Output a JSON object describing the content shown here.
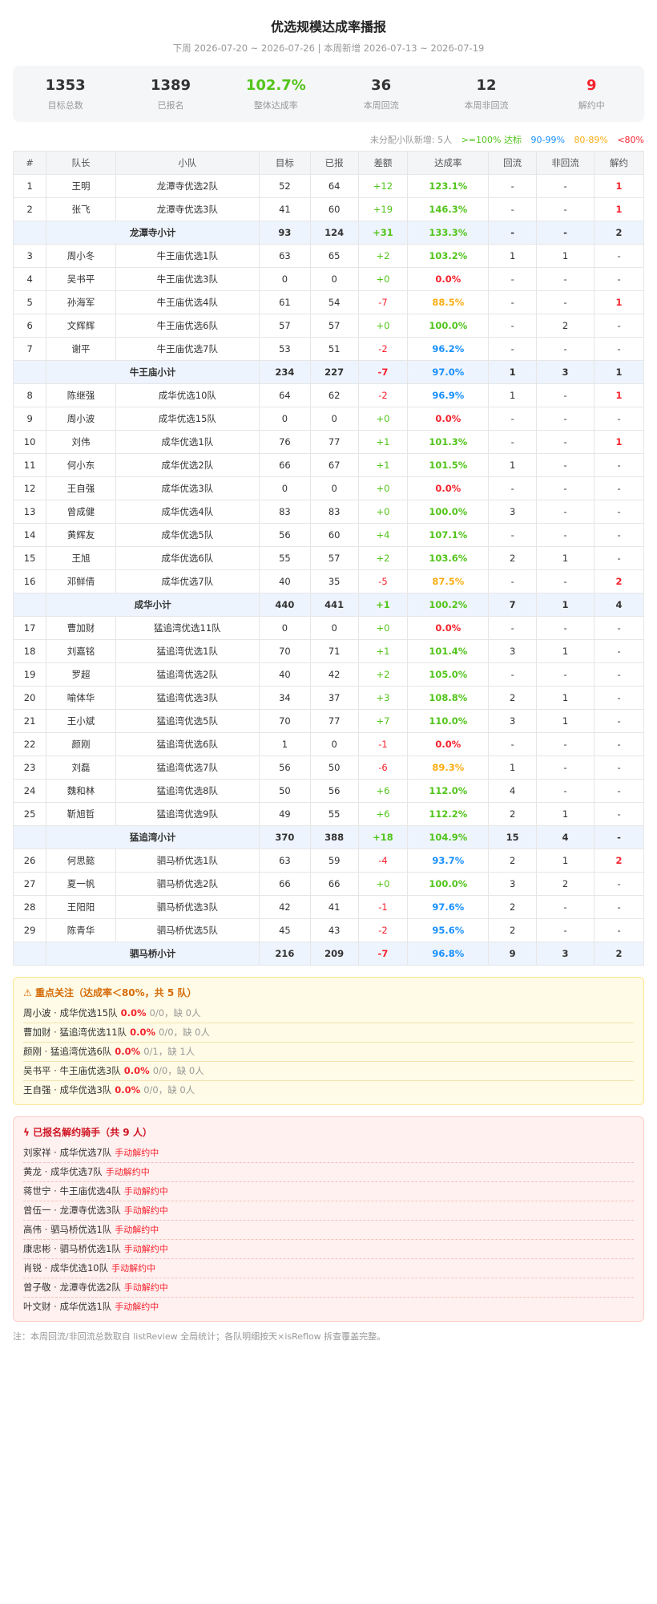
{
  "header": {
    "title": "优选规模达成率播报",
    "subtitle": "下周 2026-07-20 ~ 2026-07-26 | 本周新增 2026-07-13 ~ 2026-07-19"
  },
  "summary": [
    {
      "value": "1353",
      "label": "目标总数",
      "color": "#333333"
    },
    {
      "value": "1389",
      "label": "已报名",
      "color": "#333333"
    },
    {
      "value": "102.7%",
      "label": "整体达成率",
      "color": "#52c41a"
    },
    {
      "value": "36",
      "label": "本周回流",
      "color": "#333333"
    },
    {
      "value": "12",
      "label": "本周非回流",
      "color": "#333333"
    },
    {
      "value": "9",
      "label": "解约中",
      "color": "#f5222d"
    }
  ],
  "legend": {
    "unassigned": "未分配小队新增: 5人",
    "green": ">=100% 达标",
    "blue": "90-99%",
    "orange": "80-89%",
    "red": "<80%"
  },
  "table": {
    "headers": [
      "#",
      "队长",
      "小队",
      "目标",
      "已报",
      "差额",
      "达成率",
      "回流",
      "非回流",
      "解约"
    ],
    "rows": [
      {
        "type": "row",
        "idx": "1",
        "captain": "王明",
        "team": "龙潭寺优选2队",
        "target": "52",
        "signed": "64",
        "diff": "+12",
        "rate": "123.1%",
        "back": "-",
        "nonback": "-",
        "cancel": "1"
      },
      {
        "type": "row",
        "idx": "2",
        "captain": "张飞",
        "team": "龙潭寺优选3队",
        "target": "41",
        "signed": "60",
        "diff": "+19",
        "rate": "146.3%",
        "back": "-",
        "nonback": "-",
        "cancel": "1"
      },
      {
        "type": "sub",
        "name": "龙潭寺小计",
        "target": "93",
        "signed": "124",
        "diff": "+31",
        "rate": "133.3%",
        "back": "-",
        "nonback": "-",
        "cancel": "2"
      },
      {
        "type": "row",
        "idx": "3",
        "captain": "周小冬",
        "team": "牛王庙优选1队",
        "target": "63",
        "signed": "65",
        "diff": "+2",
        "rate": "103.2%",
        "back": "1",
        "nonback": "1",
        "cancel": "-"
      },
      {
        "type": "row",
        "idx": "4",
        "captain": "吴书平",
        "team": "牛王庙优选3队",
        "target": "0",
        "signed": "0",
        "diff": "+0",
        "rate": "0.0%",
        "back": "-",
        "nonback": "-",
        "cancel": "-"
      },
      {
        "type": "row",
        "idx": "5",
        "captain": "孙海军",
        "team": "牛王庙优选4队",
        "target": "61",
        "signed": "54",
        "diff": "-7",
        "rate": "88.5%",
        "back": "-",
        "nonback": "-",
        "cancel": "1"
      },
      {
        "type": "row",
        "idx": "6",
        "captain": "文辉辉",
        "team": "牛王庙优选6队",
        "target": "57",
        "signed": "57",
        "diff": "+0",
        "rate": "100.0%",
        "back": "-",
        "nonback": "2",
        "cancel": "-"
      },
      {
        "type": "row",
        "idx": "7",
        "captain": "谢平",
        "team": "牛王庙优选7队",
        "target": "53",
        "signed": "51",
        "diff": "-2",
        "rate": "96.2%",
        "back": "-",
        "nonback": "-",
        "cancel": "-"
      },
      {
        "type": "sub",
        "name": "牛王庙小计",
        "target": "234",
        "signed": "227",
        "diff": "-7",
        "rate": "97.0%",
        "back": "1",
        "nonback": "3",
        "cancel": "1"
      },
      {
        "type": "row",
        "idx": "8",
        "captain": "陈继强",
        "team": "成华优选10队",
        "target": "64",
        "signed": "62",
        "diff": "-2",
        "rate": "96.9%",
        "back": "1",
        "nonback": "-",
        "cancel": "1"
      },
      {
        "type": "row",
        "idx": "9",
        "captain": "周小波",
        "team": "成华优选15队",
        "target": "0",
        "signed": "0",
        "diff": "+0",
        "rate": "0.0%",
        "back": "-",
        "nonback": "-",
        "cancel": "-"
      },
      {
        "type": "row",
        "idx": "10",
        "captain": "刘伟",
        "team": "成华优选1队",
        "target": "76",
        "signed": "77",
        "diff": "+1",
        "rate": "101.3%",
        "back": "-",
        "nonback": "-",
        "cancel": "1"
      },
      {
        "type": "row",
        "idx": "11",
        "captain": "何小东",
        "team": "成华优选2队",
        "target": "66",
        "signed": "67",
        "diff": "+1",
        "rate": "101.5%",
        "back": "1",
        "nonback": "-",
        "cancel": "-"
      },
      {
        "type": "row",
        "idx": "12",
        "captain": "王自强",
        "team": "成华优选3队",
        "target": "0",
        "signed": "0",
        "diff": "+0",
        "rate": "0.0%",
        "back": "-",
        "nonback": "-",
        "cancel": "-"
      },
      {
        "type": "row",
        "idx": "13",
        "captain": "曾成健",
        "team": "成华优选4队",
        "target": "83",
        "signed": "83",
        "diff": "+0",
        "rate": "100.0%",
        "back": "3",
        "nonback": "-",
        "cancel": "-"
      },
      {
        "type": "row",
        "idx": "14",
        "captain": "黄辉友",
        "team": "成华优选5队",
        "target": "56",
        "signed": "60",
        "diff": "+4",
        "rate": "107.1%",
        "back": "-",
        "nonback": "-",
        "cancel": "-"
      },
      {
        "type": "row",
        "idx": "15",
        "captain": "王旭",
        "team": "成华优选6队",
        "target": "55",
        "signed": "57",
        "diff": "+2",
        "rate": "103.6%",
        "back": "2",
        "nonback": "1",
        "cancel": "-"
      },
      {
        "type": "row",
        "idx": "16",
        "captain": "邓鲜倩",
        "team": "成华优选7队",
        "target": "40",
        "signed": "35",
        "diff": "-5",
        "rate": "87.5%",
        "back": "-",
        "nonback": "-",
        "cancel": "2"
      },
      {
        "type": "sub",
        "name": "成华小计",
        "target": "440",
        "signed": "441",
        "diff": "+1",
        "rate": "100.2%",
        "back": "7",
        "nonback": "1",
        "cancel": "4"
      },
      {
        "type": "row",
        "idx": "17",
        "captain": "曹加财",
        "team": "猛追湾优选11队",
        "target": "0",
        "signed": "0",
        "diff": "+0",
        "rate": "0.0%",
        "back": "-",
        "nonback": "-",
        "cancel": "-"
      },
      {
        "type": "row",
        "idx": "18",
        "captain": "刘嘉铭",
        "team": "猛追湾优选1队",
        "target": "70",
        "signed": "71",
        "diff": "+1",
        "rate": "101.4%",
        "back": "3",
        "nonback": "1",
        "cancel": "-"
      },
      {
        "type": "row",
        "idx": "19",
        "captain": "罗超",
        "team": "猛追湾优选2队",
        "target": "40",
        "signed": "42",
        "diff": "+2",
        "rate": "105.0%",
        "back": "-",
        "nonback": "-",
        "cancel": "-"
      },
      {
        "type": "row",
        "idx": "20",
        "captain": "喻体华",
        "team": "猛追湾优选3队",
        "target": "34",
        "signed": "37",
        "diff": "+3",
        "rate": "108.8%",
        "back": "2",
        "nonback": "1",
        "cancel": "-"
      },
      {
        "type": "row",
        "idx": "21",
        "captain": "王小斌",
        "team": "猛追湾优选5队",
        "target": "70",
        "signed": "77",
        "diff": "+7",
        "rate": "110.0%",
        "back": "3",
        "nonback": "1",
        "cancel": "-"
      },
      {
        "type": "row",
        "idx": "22",
        "captain": "颜刚",
        "team": "猛追湾优选6队",
        "target": "1",
        "signed": "0",
        "diff": "-1",
        "rate": "0.0%",
        "back": "-",
        "nonback": "-",
        "cancel": "-"
      },
      {
        "type": "row",
        "idx": "23",
        "captain": "刘磊",
        "team": "猛追湾优选7队",
        "target": "56",
        "signed": "50",
        "diff": "-6",
        "rate": "89.3%",
        "back": "1",
        "nonback": "-",
        "cancel": "-"
      },
      {
        "type": "row",
        "idx": "24",
        "captain": "魏和林",
        "team": "猛追湾优选8队",
        "target": "50",
        "signed": "56",
        "diff": "+6",
        "rate": "112.0%",
        "back": "4",
        "nonback": "-",
        "cancel": "-"
      },
      {
        "type": "row",
        "idx": "25",
        "captain": "靳旭哲",
        "team": "猛追湾优选9队",
        "target": "49",
        "signed": "55",
        "diff": "+6",
        "rate": "112.2%",
        "back": "2",
        "nonback": "1",
        "cancel": "-"
      },
      {
        "type": "sub",
        "name": "猛追湾小计",
        "target": "370",
        "signed": "388",
        "diff": "+18",
        "rate": "104.9%",
        "back": "15",
        "nonback": "4",
        "cancel": "-"
      },
      {
        "type": "row",
        "idx": "26",
        "captain": "何思懿",
        "team": "驷马桥优选1队",
        "target": "63",
        "signed": "59",
        "diff": "-4",
        "rate": "93.7%",
        "back": "2",
        "nonback": "1",
        "cancel": "2"
      },
      {
        "type": "row",
        "idx": "27",
        "captain": "夏一帆",
        "team": "驷马桥优选2队",
        "target": "66",
        "signed": "66",
        "diff": "+0",
        "rate": "100.0%",
        "back": "3",
        "nonback": "2",
        "cancel": "-"
      },
      {
        "type": "row",
        "idx": "28",
        "captain": "王阳阳",
        "team": "驷马桥优选3队",
        "target": "42",
        "signed": "41",
        "diff": "-1",
        "rate": "97.6%",
        "back": "2",
        "nonback": "-",
        "cancel": "-"
      },
      {
        "type": "row",
        "idx": "29",
        "captain": "陈青华",
        "team": "驷马桥优选5队",
        "target": "45",
        "signed": "43",
        "diff": "-2",
        "rate": "95.6%",
        "back": "2",
        "nonback": "-",
        "cancel": "-"
      },
      {
        "type": "sub",
        "name": "驷马桥小计",
        "target": "216",
        "signed": "209",
        "diff": "-7",
        "rate": "96.8%",
        "back": "9",
        "nonback": "3",
        "cancel": "2"
      }
    ]
  },
  "focus": {
    "title": "重点关注（达成率＜80%，共 5 队）",
    "icon": "warning-icon",
    "items": [
      {
        "name": "周小波 · 成华优选15队",
        "pct": "0.0%",
        "detail": "0/0，缺 0人"
      },
      {
        "name": "曹加财 · 猛追湾优选11队",
        "pct": "0.0%",
        "detail": "0/0，缺 0人"
      },
      {
        "name": "颜刚 · 猛追湾优选6队",
        "pct": "0.0%",
        "detail": "0/1，缺 1人"
      },
      {
        "name": "吴书平 · 牛王庙优选3队",
        "pct": "0.0%",
        "detail": "0/0，缺 0人"
      },
      {
        "name": "王自强 · 成华优选3队",
        "pct": "0.0%",
        "detail": "0/0，缺 0人"
      }
    ]
  },
  "cancel": {
    "title": "已报名解约骑手（共 9 人）",
    "icon": "lightning-icon",
    "items": [
      {
        "name": "刘家祥 · 成华优选7队",
        "tag": "手动解约中"
      },
      {
        "name": "黄龙 · 成华优选7队",
        "tag": "手动解约中"
      },
      {
        "name": "蒋世宁 · 牛王庙优选4队",
        "tag": "手动解约中"
      },
      {
        "name": "曾伍一 · 龙潭寺优选3队",
        "tag": "手动解约中"
      },
      {
        "name": "高伟 · 驷马桥优选1队",
        "tag": "手动解约中"
      },
      {
        "name": "康忠彬 · 驷马桥优选1队",
        "tag": "手动解约中"
      },
      {
        "name": "肖锐 · 成华优选10队",
        "tag": "手动解约中"
      },
      {
        "name": "曾子敬 · 龙潭寺优选2队",
        "tag": "手动解约中"
      },
      {
        "name": "叶文财 · 成华优选1队",
        "tag": "手动解约中"
      }
    ]
  },
  "footer": {
    "note": "注：本周回流/非回流总数取自 listReview 全局统计；各队明细按天×isReflow 拆查覆盖完整。"
  }
}
